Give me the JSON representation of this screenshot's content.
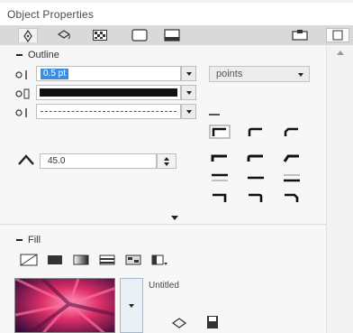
{
  "panel": {
    "title": "Object Properties"
  },
  "tabs": [
    {
      "name": "outline-tab",
      "icon": "pen-nib-icon",
      "active": true
    },
    {
      "name": "fill-tab",
      "icon": "paint-bucket-icon",
      "active": false
    },
    {
      "name": "transparency-tab",
      "icon": "checkerboard-icon",
      "active": false
    },
    {
      "name": "corners-tab",
      "icon": "rounded-rect-icon",
      "active": false
    },
    {
      "name": "summary-tab",
      "icon": "summary-icon",
      "active": false
    }
  ],
  "outline": {
    "section_label": "Outline",
    "width_value": "0.5 pt",
    "units_value": "points",
    "line_color": "#111111",
    "corners_label": "",
    "miter_value": "45.0"
  },
  "fill": {
    "section_label": "Fill",
    "preset_name": "Untitled"
  },
  "colors": {
    "accent": "#3a8de0",
    "preview_start": "#e0306a",
    "preview_end": "#3a0a3a"
  }
}
